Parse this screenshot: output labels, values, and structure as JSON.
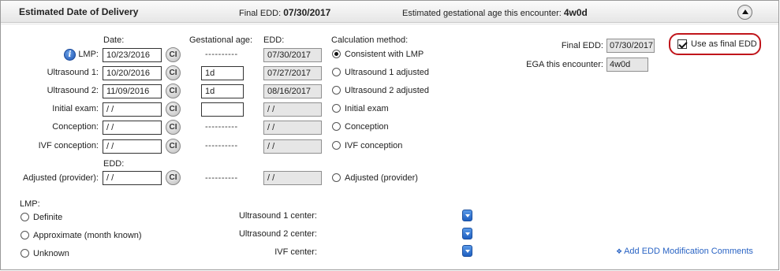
{
  "header": {
    "title": "Estimated Date of Delivery",
    "final_edd_label": "Final EDD:",
    "final_edd_value": "07/30/2017",
    "ega_label": "Estimated gestational age this encounter:",
    "ega_value": "4w0d",
    "collapse_icon": "chevron-up-icon"
  },
  "columns": {
    "date": "Date:",
    "gestational_age": "Gestational age:",
    "edd": "EDD:",
    "calc_method": "Calculation method:",
    "edd2": "EDD:"
  },
  "rows": [
    {
      "label": "LMP:",
      "date": "10/23/2016",
      "ga": "----------",
      "edd": "07/30/2017",
      "method": "Consistent with LMP",
      "selected": true
    },
    {
      "label": "Ultrasound 1:",
      "date": "10/20/2016",
      "ga": "1d",
      "edd": "07/27/2017",
      "method": "Ultrasound 1 adjusted",
      "selected": false
    },
    {
      "label": "Ultrasound 2:",
      "date": "11/09/2016",
      "ga": "1d",
      "edd": "08/16/2017",
      "method": "Ultrasound 2 adjusted",
      "selected": false
    },
    {
      "label": "Initial exam:",
      "date": " / /",
      "ga": "",
      "edd": " / /",
      "method": "Initial exam",
      "selected": false
    },
    {
      "label": "Conception:",
      "date": " / /",
      "ga": "----------",
      "edd": " / /",
      "method": "Conception",
      "selected": false
    },
    {
      "label": "IVF conception:",
      "date": " / /",
      "ga": "----------",
      "edd": " / /",
      "method": "IVF conception",
      "selected": false
    },
    {
      "label": "Adjusted (provider):",
      "date": " / /",
      "ga": "----------",
      "edd": " / /",
      "method": "Adjusted (provider)",
      "selected": false
    }
  ],
  "ci_label": "CI",
  "summary": {
    "final_edd_label": "Final EDD:",
    "final_edd_value": "07/30/2017",
    "use_final_label": "Use as final EDD",
    "use_final_checked": true,
    "ega_label": "EGA this encounter:",
    "ega_value": "4w0d"
  },
  "lmp": {
    "heading": "LMP:",
    "options": [
      "Definite",
      "Approximate (month known)",
      "Unknown"
    ]
  },
  "centers": [
    {
      "label": "Ultrasound 1 center:"
    },
    {
      "label": "Ultrasound 2 center:"
    },
    {
      "label": "IVF center:"
    }
  ],
  "add_comments_link": "Add EDD Modification Comments",
  "colors": {
    "accent": "#2a64c4",
    "highlight": "#c0151b"
  }
}
